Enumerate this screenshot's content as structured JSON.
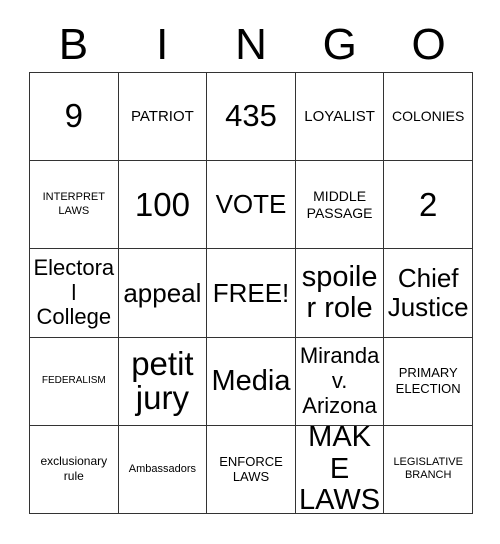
{
  "card": {
    "title": "BINGO",
    "header_letters": [
      "B",
      "I",
      "N",
      "G",
      "O"
    ],
    "free_space_label": "FREE!",
    "colors": {
      "background": "#ffffff",
      "text": "#000000",
      "grid_line": "#333333"
    },
    "rows": [
      [
        {
          "text": "9",
          "size": "sz-6xl"
        },
        {
          "text": "PATRIOT",
          "size": "sz-lg"
        },
        {
          "text": "435",
          "size": "sz-5xl"
        },
        {
          "text": "LOYALIST",
          "size": "sz-lg"
        },
        {
          "text": "COLONIES",
          "size": "sz-mdp"
        }
      ],
      [
        {
          "text": "INTERPRET LAWS",
          "size": "sz-sm"
        },
        {
          "text": "100",
          "size": "sz-6xl"
        },
        {
          "text": "VOTE",
          "size": "sz-3xl"
        },
        {
          "text": "MIDDLE PASSAGE",
          "size": "sz-mdp"
        },
        {
          "text": "2",
          "size": "sz-6xl"
        }
      ],
      [
        {
          "text": "Electoral College",
          "size": "sz-2xl"
        },
        {
          "text": "appeal",
          "size": "sz-3xl"
        },
        {
          "text": "FREE!",
          "size": "sz-3xl"
        },
        {
          "text": "spoiler role",
          "size": "sz-4xl"
        },
        {
          "text": "Chief Justice",
          "size": "sz-3xl"
        }
      ],
      [
        {
          "text": "FEDERALISM",
          "size": "sz-xs"
        },
        {
          "text": "petit jury",
          "size": "sz-6xl"
        },
        {
          "text": "Media",
          "size": "sz-4xl"
        },
        {
          "text": "Miranda v. Arizona",
          "size": "sz-2xl"
        },
        {
          "text": "PRIMARY ELECTION",
          "size": "sz-md"
        }
      ],
      [
        {
          "text": "exclusionary rule",
          "size": "sz-smp"
        },
        {
          "text": "Ambassadors",
          "size": "sz-sm"
        },
        {
          "text": "ENFORCE LAWS",
          "size": "sz-md"
        },
        {
          "text": "MAKE LAWS",
          "size": "sz-4xl"
        },
        {
          "text": "LEGISLATIVE BRANCH",
          "size": "sz-sm"
        }
      ]
    ]
  }
}
